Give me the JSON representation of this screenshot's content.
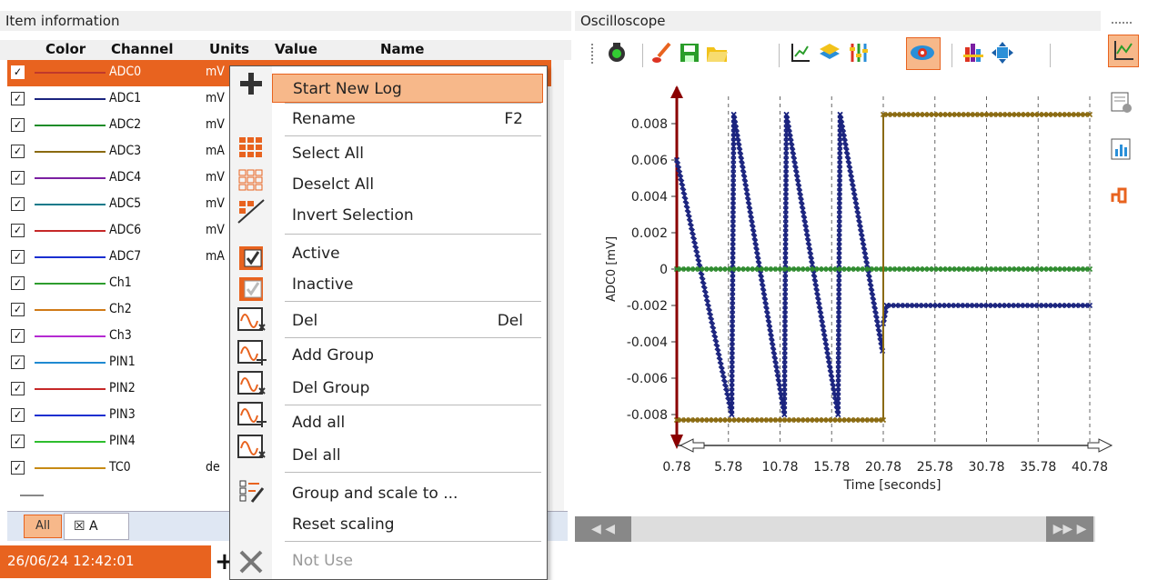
{
  "left_panel": {
    "title": "Item information",
    "headers": {
      "color": "Color",
      "channel": "Channel",
      "units": "Units",
      "value": "Value",
      "name": "Name"
    },
    "rows": [
      {
        "channel": "ADC0",
        "units": "mV",
        "color": "#c0392b",
        "checked": true,
        "selected": true
      },
      {
        "channel": "ADC1",
        "units": "mV",
        "color": "#1a237e",
        "checked": true
      },
      {
        "channel": "ADC2",
        "units": "mV",
        "color": "#1e8c28",
        "checked": true
      },
      {
        "channel": "ADC3",
        "units": "mA",
        "color": "#8a6a10",
        "checked": true
      },
      {
        "channel": "ADC4",
        "units": "mV",
        "color": "#7b1fa2",
        "checked": true
      },
      {
        "channel": "ADC5",
        "units": "mV",
        "color": "#127a8a",
        "checked": true
      },
      {
        "channel": "ADC6",
        "units": "mV",
        "color": "#c62828",
        "checked": true
      },
      {
        "channel": "ADC7",
        "units": "mA",
        "color": "#1a2fd0",
        "checked": true
      },
      {
        "channel": "Ch1",
        "units": "",
        "color": "#2e9d2e",
        "checked": true
      },
      {
        "channel": "Ch2",
        "units": "",
        "color": "#d07a16",
        "checked": true
      },
      {
        "channel": "Ch3",
        "units": "",
        "color": "#b52ad1",
        "checked": true
      },
      {
        "channel": "PIN1",
        "units": "",
        "color": "#1f8ad1",
        "checked": true
      },
      {
        "channel": "PIN2",
        "units": "",
        "color": "#c62828",
        "checked": true
      },
      {
        "channel": "PIN3",
        "units": "",
        "color": "#1a2fd0",
        "checked": true
      },
      {
        "channel": "PIN4",
        "units": "",
        "color": "#2ebd2e",
        "checked": true
      },
      {
        "channel": "TC0",
        "units": "de",
        "color": "#c78a14",
        "checked": true
      }
    ],
    "tabs": [
      {
        "label": "All"
      },
      {
        "label": "A",
        "close": "☒"
      }
    ],
    "status_time": "26/06/24 12:42:01"
  },
  "context_menu": {
    "items": [
      {
        "label": "Start New Log",
        "shortcut": "",
        "highlight": true
      },
      {
        "label": "Rename",
        "shortcut": "F2"
      },
      {
        "label": "Select All",
        "shortcut": ""
      },
      {
        "label": "Deselct All",
        "shortcut": ""
      },
      {
        "label": "Invert Selection",
        "shortcut": ""
      },
      {
        "label": "Active",
        "shortcut": ""
      },
      {
        "label": "Inactive",
        "shortcut": ""
      },
      {
        "label": "Del",
        "shortcut": "Del"
      },
      {
        "label": "Add Group",
        "shortcut": ""
      },
      {
        "label": "Del Group",
        "shortcut": ""
      },
      {
        "label": "Add all",
        "shortcut": ""
      },
      {
        "label": "Del all",
        "shortcut": ""
      },
      {
        "label": "Group and scale to ...",
        "shortcut": ""
      },
      {
        "label": "Reset scaling",
        "shortcut": ""
      },
      {
        "label": "Not Use",
        "shortcut": "",
        "disabled": true
      }
    ]
  },
  "oscilloscope": {
    "title": "Oscilloscope",
    "toolbar_icons": [
      "record-icon",
      "brush-icon",
      "save-icon",
      "open-folder-icon",
      "axis-icon",
      "layers-icon",
      "sliders-icon",
      "eye-icon",
      "color-icon",
      "zoom-fit-icon"
    ],
    "side_icons": [
      "chart-view-icon",
      "settings-sheet-icon",
      "bar-chart-icon",
      "step-chart-icon"
    ]
  },
  "chart_data": {
    "type": "line",
    "xlabel": "Time [seconds]",
    "ylabel": "ADC0  [mV]",
    "x_ticks": [
      "0.78",
      "5.78",
      "10.78",
      "15.78",
      "20.78",
      "25.78",
      "30.78",
      "35.78",
      "40.78"
    ],
    "y_ticks": [
      "0.008",
      "0.006",
      "0.004",
      "0.002",
      "0",
      "-0.002",
      "-0.004",
      "-0.006",
      "-0.008"
    ],
    "xlim": [
      0.78,
      40.78
    ],
    "ylim": [
      -0.0095,
      0.0095
    ],
    "grid": "vertical dashed",
    "series": [
      {
        "color": "#1a237e",
        "points": [
          [
            0.78,
            0.006
          ],
          [
            6.1,
            -0.008
          ],
          [
            6.3,
            0.0085
          ],
          [
            11.2,
            -0.008
          ],
          [
            11.4,
            0.0085
          ],
          [
            16.4,
            -0.008
          ],
          [
            16.6,
            0.0085
          ],
          [
            20.7,
            -0.0045
          ],
          [
            20.78,
            -0.003
          ],
          [
            21.1,
            -0.002
          ],
          [
            40.78,
            -0.002
          ]
        ]
      },
      {
        "color": "#2e8b2e",
        "points": [
          [
            0.78,
            0.0
          ],
          [
            40.78,
            0.0
          ]
        ]
      },
      {
        "color": "#8a6a10",
        "points": [
          [
            0.78,
            -0.0083
          ],
          [
            20.78,
            -0.0083
          ],
          [
            20.78,
            0.0085
          ],
          [
            40.78,
            0.0085
          ]
        ]
      }
    ]
  }
}
